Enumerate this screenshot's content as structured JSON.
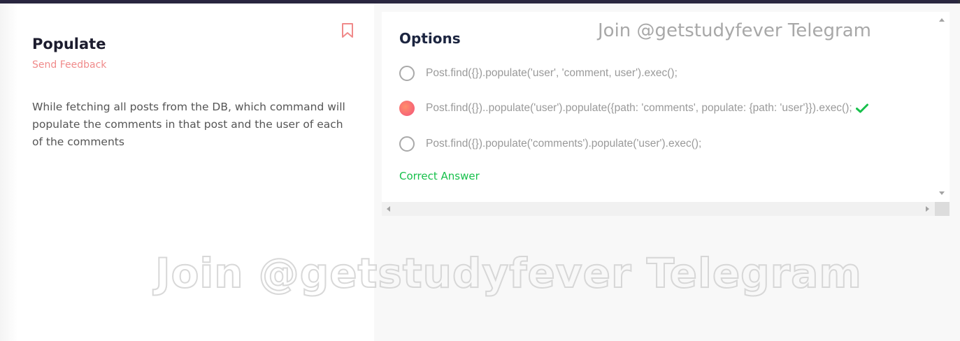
{
  "question": {
    "title": "Populate",
    "feedback_label": "Send Feedback",
    "text": "While fetching all posts from the DB, which command will populate the comments in that post and the user of each of the comments",
    "bookmark_icon": "bookmark-icon"
  },
  "options_panel": {
    "title": "Options",
    "options": [
      {
        "text": "Post.find({}).populate('user', 'comment, user').exec();",
        "selected": false
      },
      {
        "text": "Post.find({})..populate('user').populate({path: 'comments', populate: {path: 'user'}}).exec();",
        "selected": true,
        "correct": true
      },
      {
        "text": "Post.find({}).populate('comments').populate('user').exec();",
        "selected": false
      }
    ],
    "result_label": "Correct Answer"
  },
  "watermark": {
    "text": "Join @getstudyfever Telegram"
  },
  "colors": {
    "accent": "#f08a8a",
    "success": "#17c04b",
    "selected_radio": "#f3527b"
  }
}
